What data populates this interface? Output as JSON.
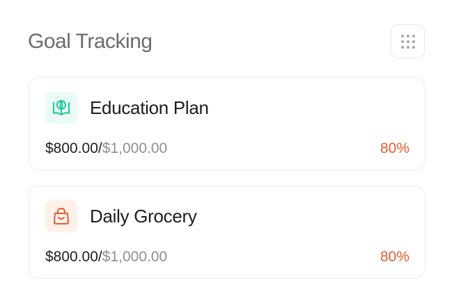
{
  "header": {
    "title": "Goal Tracking",
    "menu_icon": "grid-dots-icon"
  },
  "goals": [
    {
      "name": "Education Plan",
      "icon": "book-globe-icon",
      "icon_color": "#1ec79a",
      "icon_bg": "#eafbf6",
      "current": "$800.00",
      "separator": "/",
      "target": "$1,000.00",
      "percent": "80%",
      "progress": 0.8
    },
    {
      "name": "Daily Grocery",
      "icon": "shopping-bag-icon",
      "icon_color": "#ef5a2e",
      "icon_bg": "#fff1ea",
      "current": "$800.00",
      "separator": "/",
      "target": "$1,000.00",
      "percent": "80%",
      "progress": 0.8
    }
  ],
  "colors": {
    "title": "#6b6b6b",
    "text": "#1a1f1c",
    "muted": "#8f8f8f",
    "accent": "#ef5a2e"
  }
}
